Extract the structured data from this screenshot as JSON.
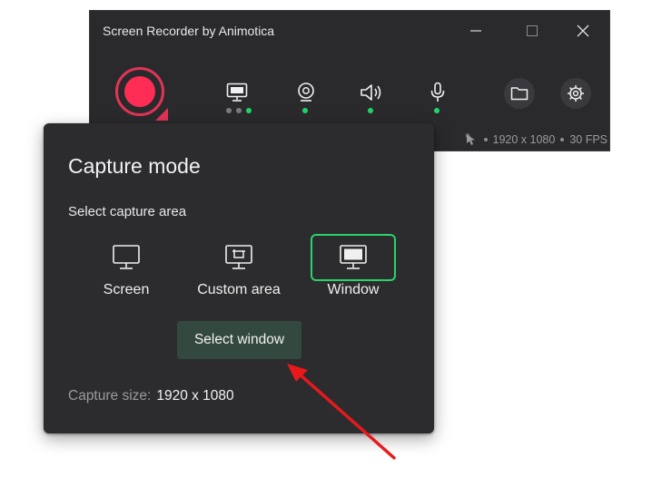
{
  "window": {
    "title": "Screen Recorder by Animotica",
    "controls": [
      "minimize-icon",
      "maximize-icon",
      "close-icon"
    ]
  },
  "toolbar": {
    "record_icon": "record-icon",
    "tools": [
      {
        "icon": "monitor-icon",
        "dots": [
          "off",
          "off",
          "on"
        ]
      },
      {
        "icon": "webcam-icon",
        "dots": [
          "on"
        ]
      },
      {
        "icon": "speaker-icon",
        "dots": [
          "on"
        ]
      },
      {
        "icon": "microphone-icon",
        "dots": [
          "on"
        ]
      }
    ],
    "folder_icon": "folder-icon",
    "settings_icon": "gear-icon"
  },
  "status": {
    "cursor_icon": "cursor-highlight-icon",
    "resolution": "1920 x 1080",
    "fps": "30 FPS"
  },
  "capture_panel": {
    "title": "Capture mode",
    "subtitle": "Select capture area",
    "modes": [
      {
        "label": "Screen",
        "icon": "screen-icon",
        "selected": false
      },
      {
        "label": "Custom area",
        "icon": "custom-area-icon",
        "selected": false
      },
      {
        "label": "Window",
        "icon": "window-icon",
        "selected": true
      }
    ],
    "select_button": "Select window",
    "capture_size_label": "Capture size:",
    "capture_size_value": "1920 x 1080"
  },
  "colors": {
    "accent_green": "#2ad36c",
    "record_red": "#ff2c55",
    "panel_bg": "#2c2c2f",
    "annotation_arrow": "#e8191b"
  }
}
